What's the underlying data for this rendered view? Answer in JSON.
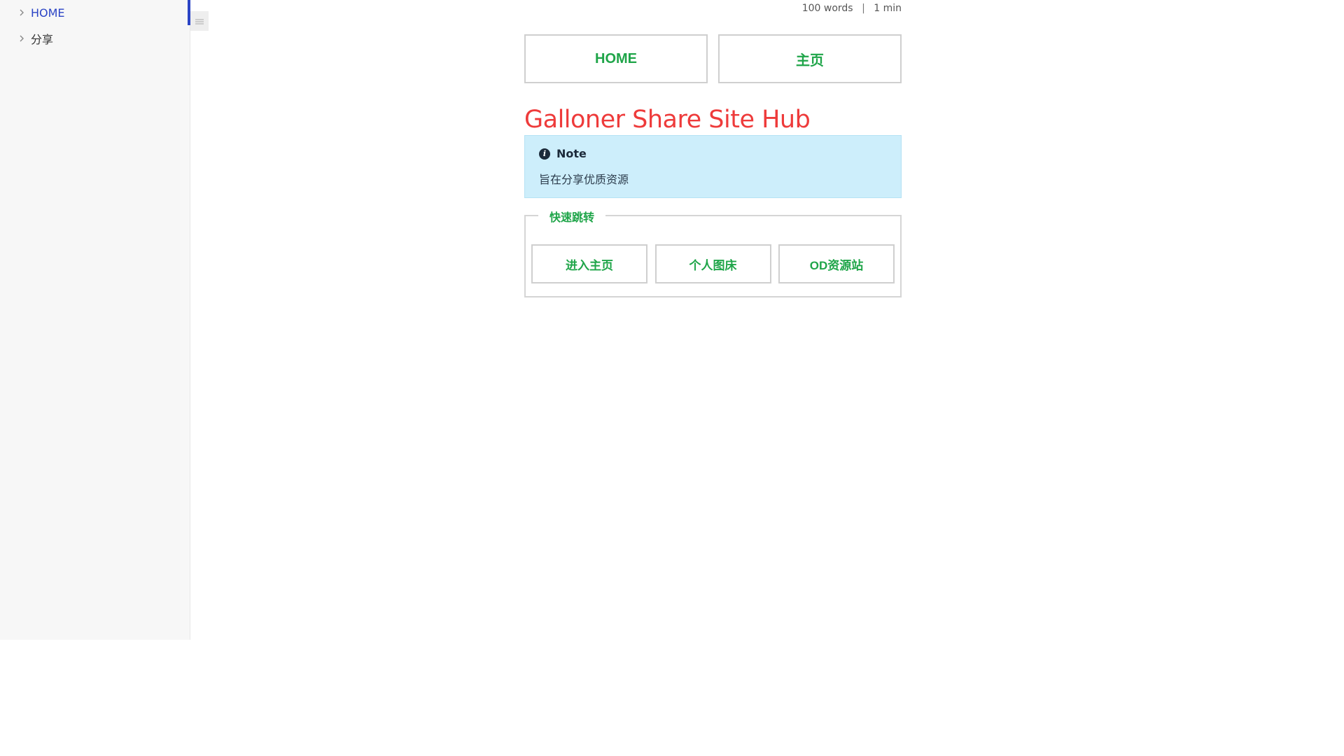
{
  "sidebar": {
    "items": [
      {
        "label": "HOME",
        "icon": "chevron-right-icon",
        "active": true
      },
      {
        "label": "分享",
        "icon": "chevron-right-icon",
        "active": false
      }
    ],
    "toggle_icon": "menu-icon"
  },
  "meta": {
    "words": "100 words",
    "separator": "|",
    "read_time": "1 min"
  },
  "top_buttons": [
    {
      "label": "HOME"
    },
    {
      "label": "主页"
    }
  ],
  "page_title": "Galloner Share Site Hub",
  "note": {
    "icon": "info-icon",
    "title": "Note",
    "body": "旨在分享优质资源"
  },
  "quick_jump": {
    "legend": "快速跳转",
    "buttons": [
      {
        "label": "进入主页"
      },
      {
        "label": "个人图床"
      },
      {
        "label": "OD资源站"
      }
    ]
  },
  "colors": {
    "accent_green": "#1fa549",
    "title_red": "#ee3b3b",
    "active_blue": "#2b44c5",
    "note_bg": "#cdeefb"
  }
}
